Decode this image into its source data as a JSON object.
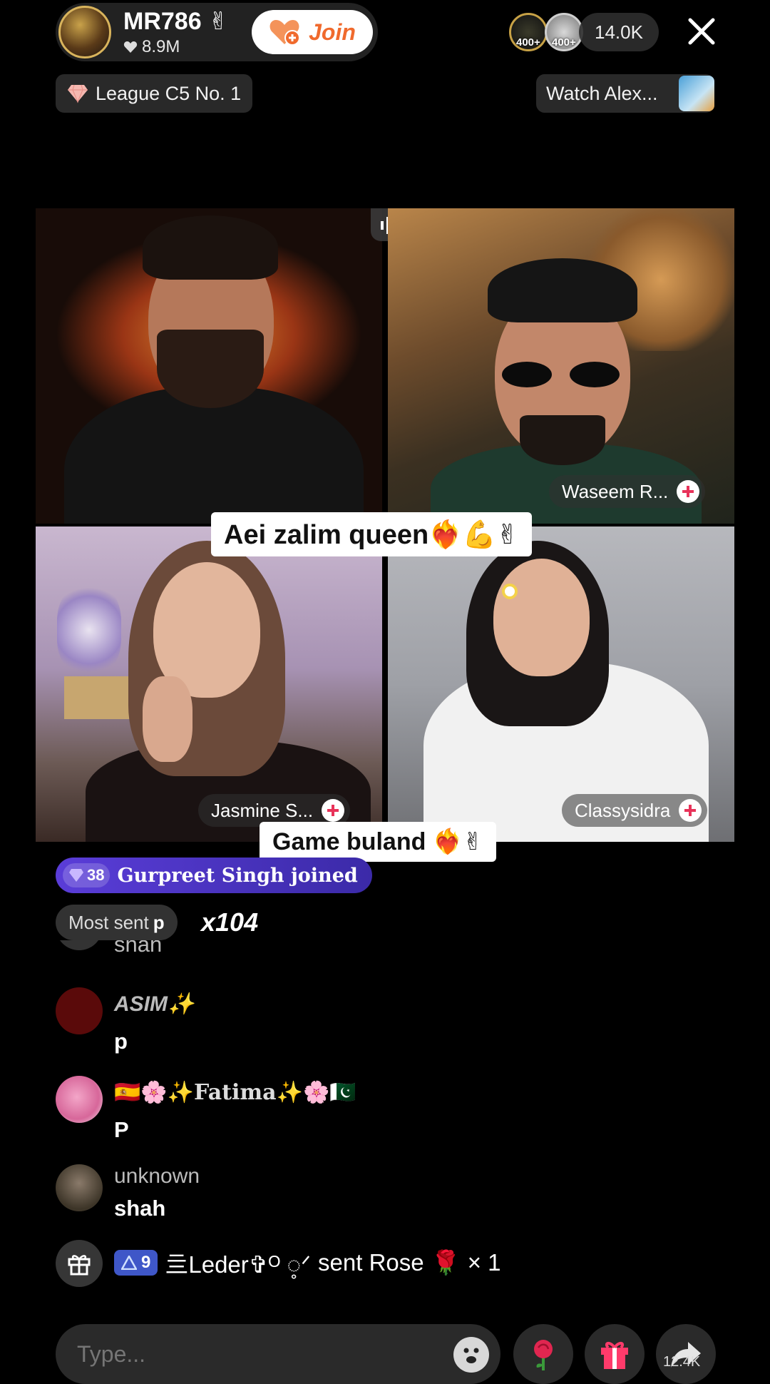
{
  "host": {
    "name": "MR786",
    "name_emoji": "✌",
    "likes": "8.9M",
    "join_label": "Join"
  },
  "top_right": {
    "rank_badges": [
      "400+",
      "400+"
    ],
    "viewer_count": "14.0K"
  },
  "league": {
    "label": "League C5 No. 1"
  },
  "watch": {
    "label": "Watch Alex..."
  },
  "guests": [
    {
      "name": "Waseem R..."
    },
    {
      "name": "Jasmine S..."
    },
    {
      "name": "Classysidra"
    }
  ],
  "captions": [
    {
      "text": "Aei zalim queen❤️‍🔥💪✌"
    },
    {
      "text": "Game buland ❤️‍🔥✌"
    }
  ],
  "joined": {
    "level": "38",
    "text": "Gurpreet Singh joined"
  },
  "most_sent": {
    "label": "Most sent",
    "value": "p",
    "count": "x104"
  },
  "chat": [
    {
      "name": "shah",
      "message": ""
    },
    {
      "name": "ASIM✨",
      "message": "p"
    },
    {
      "name": "🇪🇸🌸✨Fatima✨🌸🇵🇰",
      "message": "P"
    },
    {
      "name": "unknown",
      "message": "shah"
    }
  ],
  "gift_event": {
    "level": "9",
    "sender": "亖Leder✞ᴼ ◌̥ᐟ",
    "action": "sent Rose",
    "emoji": "🌹",
    "count": "× 1"
  },
  "bottom": {
    "input_placeholder": "Type...",
    "share_count": "12.4K"
  },
  "colors": {
    "join_text": "#f06a2d",
    "joined_pill": "#4a34c4",
    "plus_icon": "#e8335a",
    "level9_badge": "#3f57c8"
  }
}
